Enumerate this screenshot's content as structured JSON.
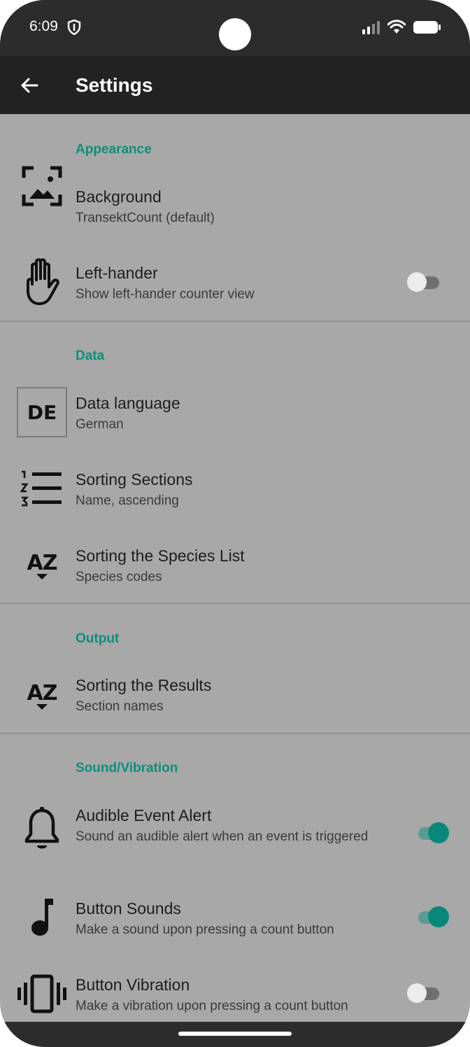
{
  "status_bar": {
    "time": "6:09"
  },
  "app_bar": {
    "title": "Settings"
  },
  "sections": {
    "appearance": {
      "header": "Appearance"
    },
    "data": {
      "header": "Data"
    },
    "output": {
      "header": "Output"
    },
    "sound": {
      "header": "Sound/Vibration"
    }
  },
  "items": {
    "background": {
      "title": "Background",
      "summary": "TransektCount (default)",
      "icon": "wallpaper-icon"
    },
    "left_hander": {
      "title": "Left-hander",
      "summary": "Show left-hander counter view",
      "icon": "hand-icon",
      "enabled": false
    },
    "data_language": {
      "title": "Data language",
      "summary": "German",
      "icon_text": "DE",
      "icon": "language-de-icon"
    },
    "sorting_sections": {
      "title": "Sorting Sections",
      "summary": "Name, ascending",
      "icon": "numbered-list-icon"
    },
    "sorting_species": {
      "title": "Sorting the Species List",
      "summary": "Species codes",
      "icon_text": "AZ",
      "icon": "sort-az-icon"
    },
    "sorting_results": {
      "title": "Sorting the Results",
      "summary": "Section names",
      "icon_text": "AZ",
      "icon": "sort-az-icon"
    },
    "audible_alert": {
      "title": "Audible Event Alert",
      "summary": "Sound an audible alert when an event is triggered",
      "icon": "bell-icon",
      "enabled": true
    },
    "button_sounds": {
      "title": "Button Sounds",
      "summary": "Make a sound upon pressing a count button",
      "icon": "music-note-icon",
      "enabled": true
    },
    "button_vibration": {
      "title": "Button Vibration",
      "summary": "Make a vibration upon pressing a count button",
      "icon": "vibration-icon",
      "enabled": false
    }
  },
  "colors": {
    "accent": "#0b8f7f",
    "background": "#a8a8a8",
    "app_bar": "#222222"
  }
}
